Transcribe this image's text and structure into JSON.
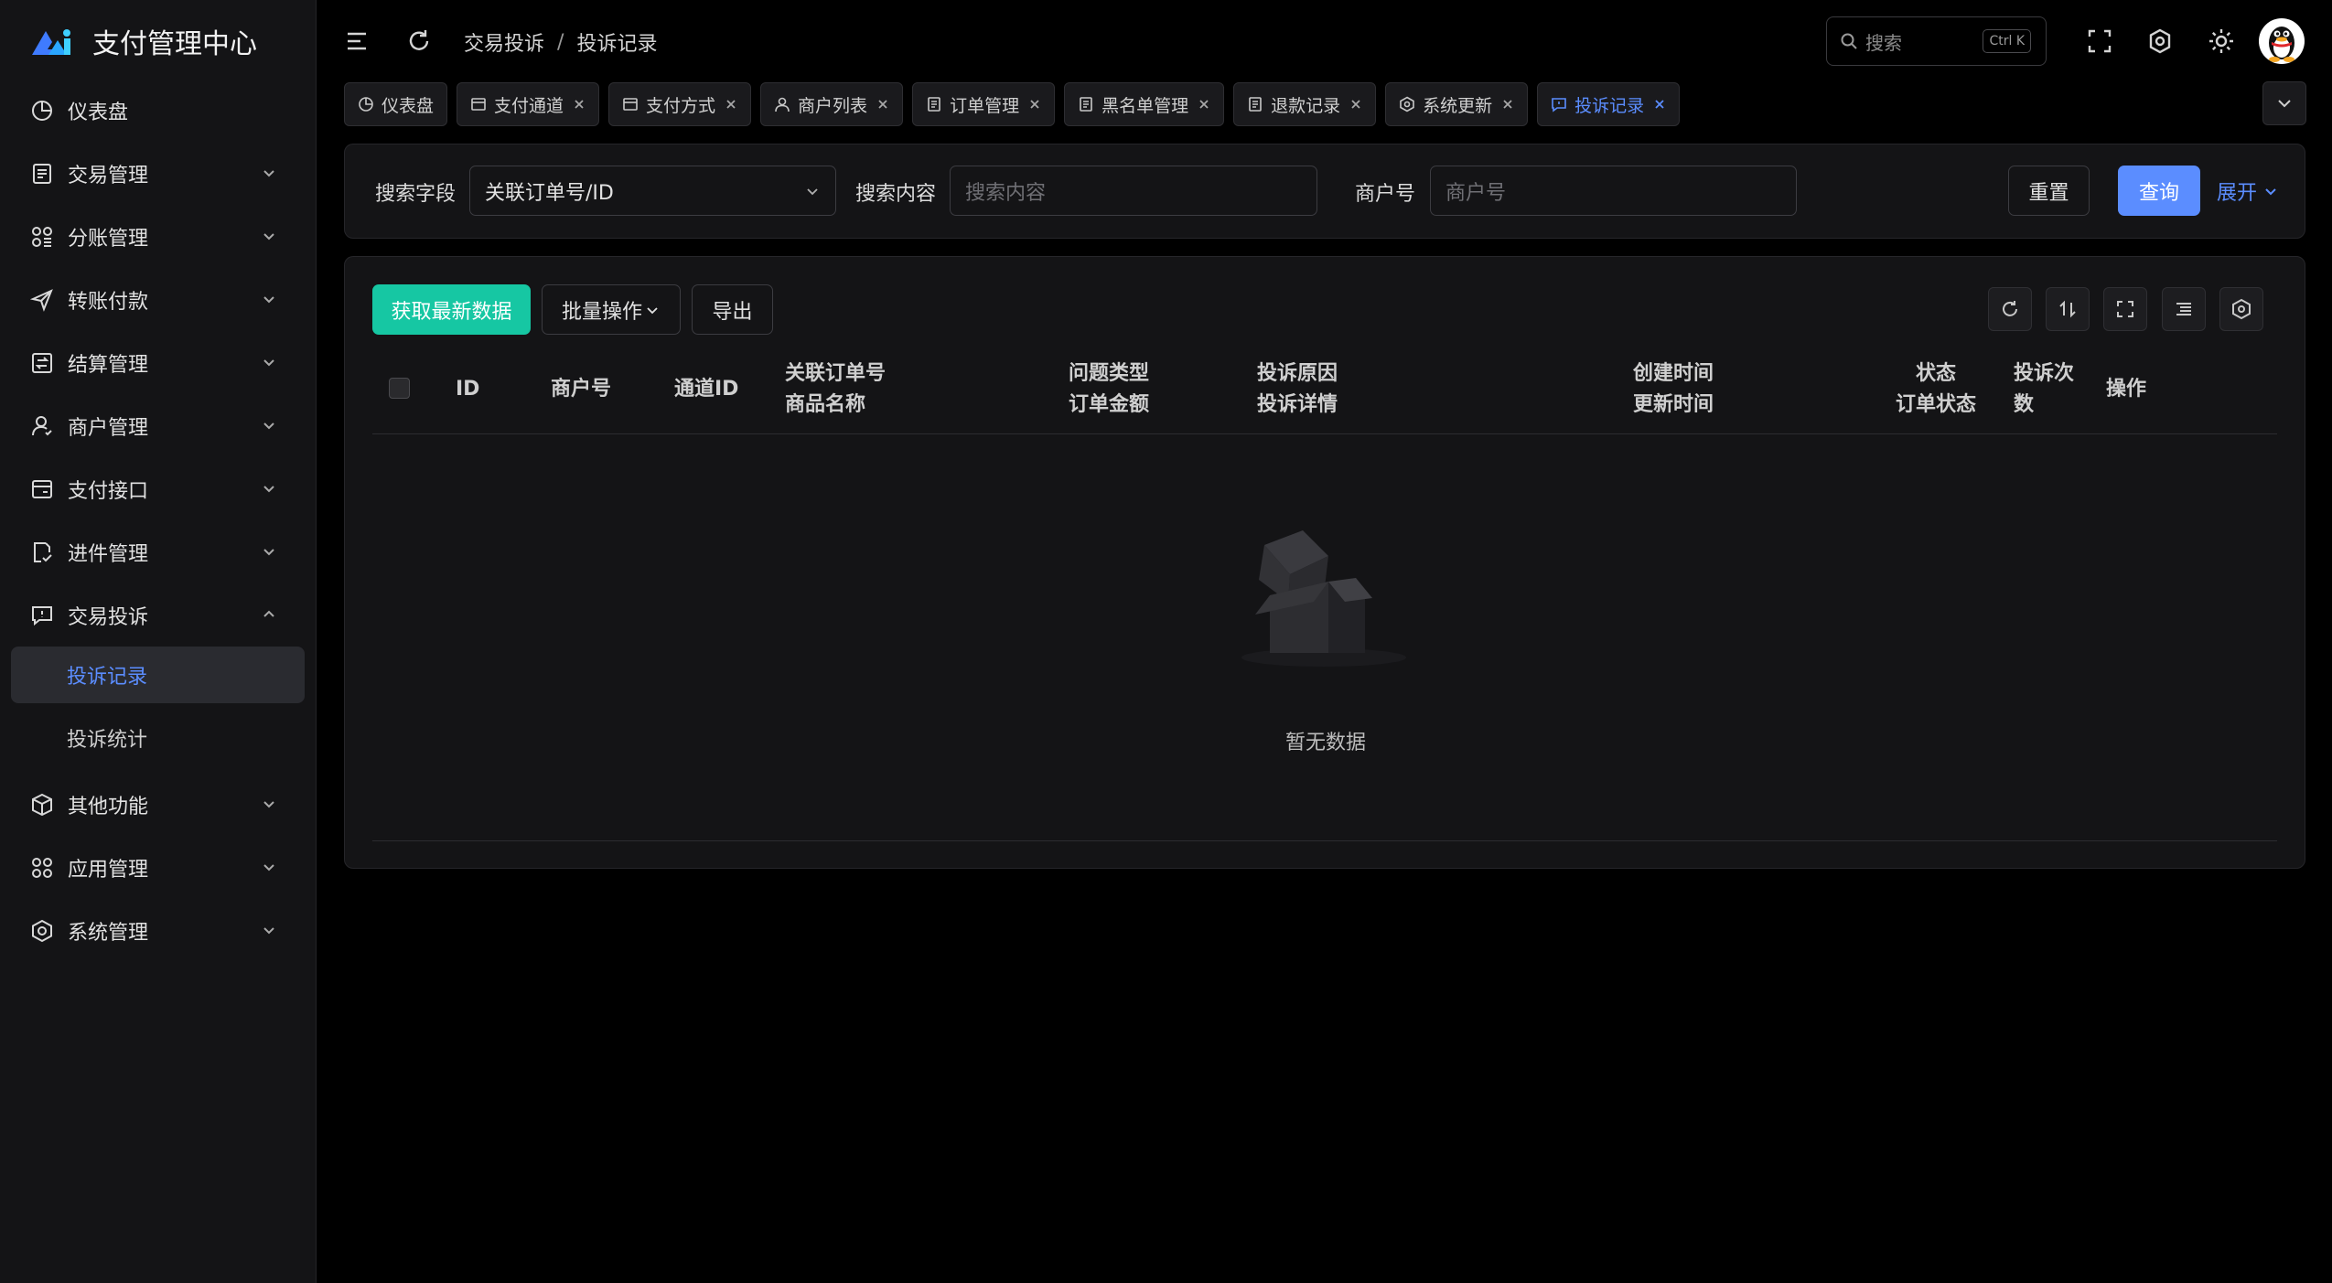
{
  "app": {
    "title": "支付管理中心"
  },
  "sidebar": {
    "items": [
      {
        "label": "仪表盘",
        "icon": "dashboard-icon"
      },
      {
        "label": "交易管理",
        "icon": "document-icon"
      },
      {
        "label": "分账管理",
        "icon": "split-icon"
      },
      {
        "label": "转账付款",
        "icon": "send-icon"
      },
      {
        "label": "结算管理",
        "icon": "settlement-icon"
      },
      {
        "label": "商户管理",
        "icon": "user-icon"
      },
      {
        "label": "支付接口",
        "icon": "card-icon"
      },
      {
        "label": "进件管理",
        "icon": "file-check-icon"
      },
      {
        "label": "交易投诉",
        "icon": "complaint-icon",
        "expanded": true
      },
      {
        "label": "其他功能",
        "icon": "cube-icon"
      },
      {
        "label": "应用管理",
        "icon": "apps-icon"
      },
      {
        "label": "系统管理",
        "icon": "hexagon-settings-icon"
      }
    ],
    "submenu": [
      {
        "label": "投诉记录",
        "active": true
      },
      {
        "label": "投诉统计",
        "active": false
      }
    ]
  },
  "header": {
    "breadcrumb": [
      "交易投诉",
      "投诉记录"
    ],
    "breadcrumb_sep": "/",
    "search_placeholder": "搜索",
    "search_shortcut": "Ctrl K"
  },
  "tabs": [
    {
      "label": "仪表盘",
      "closable": false
    },
    {
      "label": "支付通道",
      "closable": true
    },
    {
      "label": "支付方式",
      "closable": true
    },
    {
      "label": "商户列表",
      "closable": true
    },
    {
      "label": "订单管理",
      "closable": true
    },
    {
      "label": "黑名单管理",
      "closable": true
    },
    {
      "label": "退款记录",
      "closable": true
    },
    {
      "label": "系统更新",
      "closable": true
    },
    {
      "label": "投诉记录",
      "closable": true,
      "active": true
    }
  ],
  "filter": {
    "field_label": "搜索字段",
    "field_value": "关联订单号/ID",
    "content_label": "搜索内容",
    "content_placeholder": "搜索内容",
    "merchant_label": "商户号",
    "merchant_placeholder": "商户号",
    "reset": "重置",
    "query": "查询",
    "expand": "展开"
  },
  "toolbar": {
    "fetch": "获取最新数据",
    "batch": "批量操作",
    "export": "导出"
  },
  "table": {
    "columns": [
      {
        "line1": "ID"
      },
      {
        "line1": "商户号"
      },
      {
        "line1": "通道ID"
      },
      {
        "line1": "关联订单号",
        "line2": "商品名称"
      },
      {
        "line1": "问题类型",
        "line2": "订单金额"
      },
      {
        "line1": "投诉原因",
        "line2": "投诉详情"
      },
      {
        "line1": "创建时间",
        "line2": "更新时间"
      },
      {
        "line1": "状态",
        "line2": "订单状态"
      },
      {
        "line1": "投诉次",
        "line2": "数"
      },
      {
        "line1": "操作"
      }
    ],
    "rows": [],
    "empty_text": "暂无数据"
  },
  "colors": {
    "accent": "#5b8dff",
    "success": "#16c7a3",
    "background": "#000000",
    "panel": "#141416"
  }
}
